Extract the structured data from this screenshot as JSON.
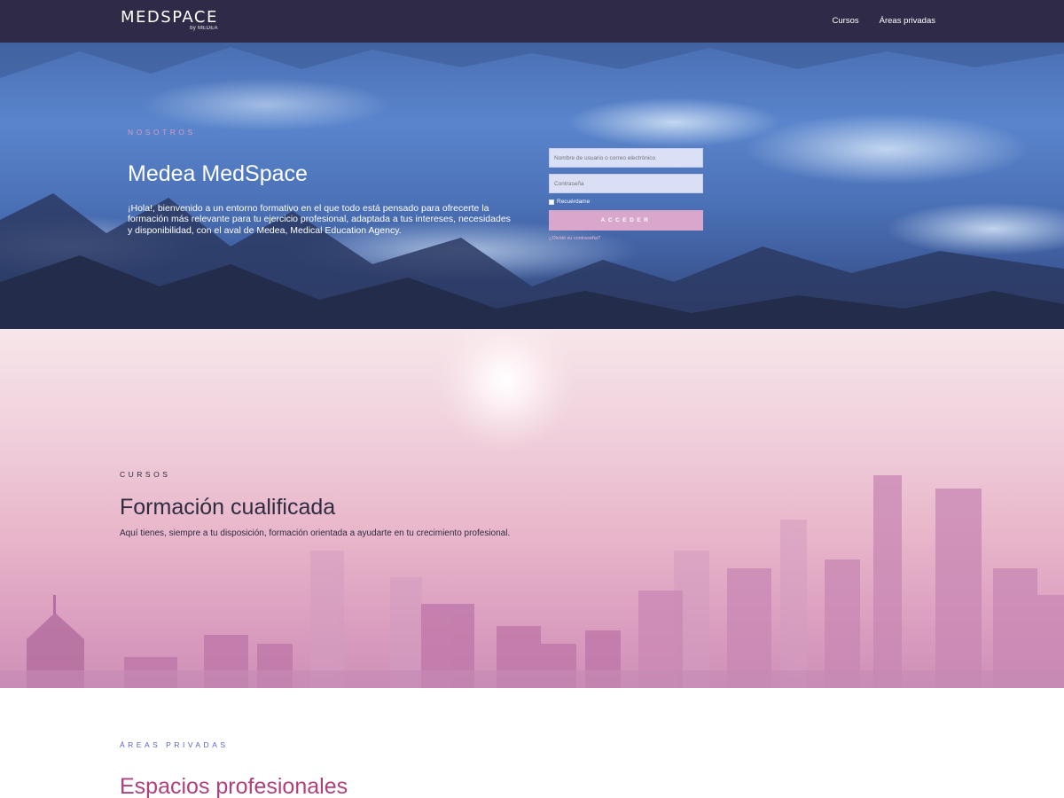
{
  "header": {
    "logo_text": "MEDSPACE",
    "logo_sub": "by MEDEA",
    "nav": [
      {
        "label": "Cursos"
      },
      {
        "label": "Áreas privadas"
      }
    ]
  },
  "hero": {
    "eyebrow": "NOSOTROS",
    "title": "Medea MedSpace",
    "text": "¡Hola!, bienvenido a un entorno formativo en el que todo está pensado para ofrecerte la formación más relevante para tu ejercicio profesional, adaptada a tus intereses, necesidades y disponibilidad, con el aval de Medea, Medical Education Agency."
  },
  "login": {
    "username_placeholder": "Nombre de usuario o correo electrónico",
    "password_placeholder": "Contraseña",
    "remember_label": "Recuérdame",
    "submit_label": "ACCEDER",
    "forgot_label": "¿Olvidó su contraseña?"
  },
  "courses": {
    "eyebrow": "CURSOS",
    "title": "Formación cualificada",
    "text": "Aquí tienes, siempre a tu disposición, formación orientada a ayudarte en tu crecimiento profesional."
  },
  "areas": {
    "eyebrow": "ÁREAS PRIVADAS",
    "title": "Espacios profesionales"
  },
  "colors": {
    "header_bg": "#2e2a47",
    "accent_pink": "#d9a6cc",
    "areas_eyebrow": "#5b63c8",
    "areas_title": "#b0407c"
  }
}
